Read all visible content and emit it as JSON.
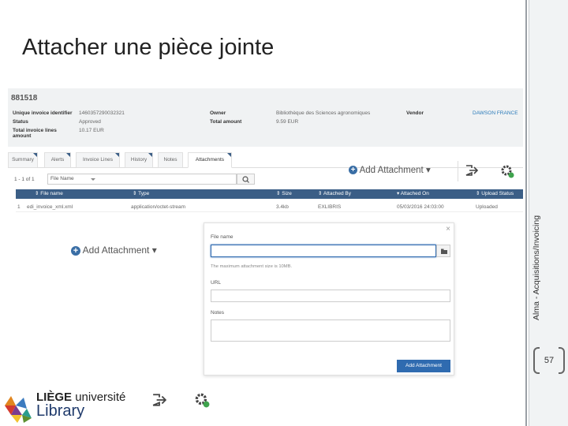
{
  "slide": {
    "title": "Attacher une pièce jointe",
    "side_text": "Alma - Acquisitions/Invoicing",
    "page_number": "57"
  },
  "record": {
    "id": "881518",
    "fields": [
      {
        "key": "Unique invoice identifier",
        "value": "1460357290032321"
      },
      {
        "key": "Status",
        "value": "Approved"
      },
      {
        "key": "Total invoice lines amount",
        "value": "10.17 EUR"
      },
      {
        "key": "Owner",
        "value": "Bibliothèque des Sciences agronomiques"
      },
      {
        "key": "Total amount",
        "value": "9.59 EUR"
      },
      {
        "key": "Vendor",
        "value": "DAWSON FRANCE"
      }
    ]
  },
  "tabs": [
    "Summary",
    "Alerts",
    "Invoice Lines",
    "History",
    "Notes",
    "Attachments"
  ],
  "active_tab": "Attachments",
  "toolbar": {
    "add_attachment_label": "Add Attachment"
  },
  "list": {
    "pager": "1 - 1 of 1",
    "sort_select": "File Name",
    "columns": [
      "File name",
      "Type",
      "Size",
      "Attached By",
      "Attached On",
      "Upload Status"
    ],
    "rows": [
      {
        "num": "1",
        "file": "edi_invoice_xml.xml",
        "type": "application/octet-stream",
        "size": "3.4kb",
        "by": "EXLIBRIS",
        "on": "05/03/2016 24:03:00",
        "status": "Uploaded"
      }
    ]
  },
  "dialog": {
    "file_name_label": "File name",
    "hint": "The maximum attachment size is 10MB.",
    "url_label": "URL",
    "notes_label": "Notes",
    "submit_label": "Add Attachment",
    "close_glyph": "×"
  },
  "logo": {
    "prefix": "LIÈGE",
    "suffix": "université",
    "name": "Library"
  },
  "colors": {
    "accent": "#3b5e86",
    "primary_button": "#2f6bb0",
    "gear_dot": "#3fa34d"
  }
}
